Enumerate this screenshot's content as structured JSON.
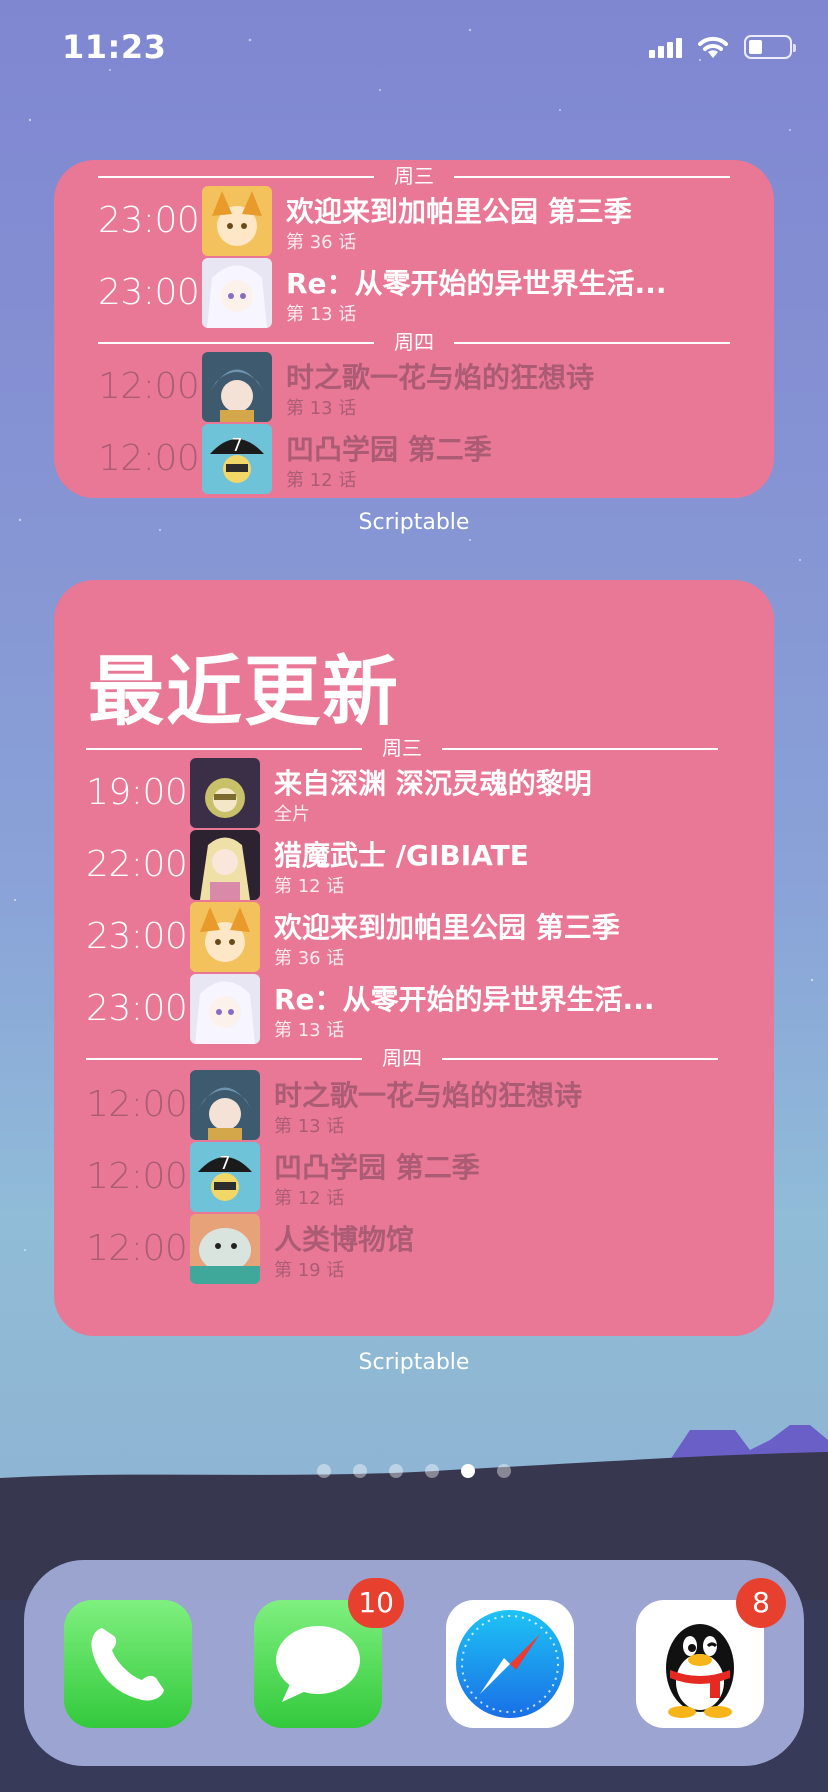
{
  "status_bar": {
    "time": "11:23",
    "battery_level": 0.3
  },
  "widgets": [
    {
      "label": "Scriptable",
      "days": [
        {
          "day": "周三",
          "items": [
            {
              "time": "23:00",
              "title": "欢迎来到加帕里公园 第三季",
              "episode": "第 36 话",
              "aired": true
            },
            {
              "time": "23:00",
              "title": "Re：从零开始的异世界生活...",
              "episode": "第 13 话",
              "aired": true
            }
          ]
        },
        {
          "day": "周四",
          "items": [
            {
              "time": "12:00",
              "title": "时之歌一花与焰的狂想诗",
              "episode": "第 13 话",
              "aired": false
            },
            {
              "time": "12:00",
              "title": "凹凸学园 第二季",
              "episode": "第 12 话",
              "aired": false
            }
          ]
        }
      ]
    },
    {
      "label": "Scriptable",
      "title": "最近更新",
      "days": [
        {
          "day": "周三",
          "items": [
            {
              "time": "19:00",
              "title": "来自深渊 深沉灵魂的黎明",
              "episode": "全片",
              "aired": true
            },
            {
              "time": "22:00",
              "title": "猎魔武士 /GIBIATE",
              "episode": "第 12 话",
              "aired": true
            },
            {
              "time": "23:00",
              "title": "欢迎来到加帕里公园 第三季",
              "episode": "第 36 话",
              "aired": true
            },
            {
              "time": "23:00",
              "title": "Re：从零开始的异世界生活...",
              "episode": "第 13 话",
              "aired": true
            }
          ]
        },
        {
          "day": "周四",
          "items": [
            {
              "time": "12:00",
              "title": "时之歌一花与焰的狂想诗",
              "episode": "第 13 话",
              "aired": false
            },
            {
              "time": "12:00",
              "title": "凹凸学园 第二季",
              "episode": "第 12 话",
              "aired": false
            },
            {
              "time": "12:00",
              "title": "人类博物馆",
              "episode": "第 19 话",
              "aired": false
            }
          ]
        }
      ]
    }
  ],
  "page_dots": {
    "count": 6,
    "active_index": 4
  },
  "dock": [
    {
      "name": "phone-app",
      "icon": "phone-icon",
      "badge": ""
    },
    {
      "name": "messages-app",
      "icon": "messages-icon",
      "badge": "10"
    },
    {
      "name": "safari-app",
      "icon": "safari-compass-icon",
      "badge": ""
    },
    {
      "name": "qq-app",
      "icon": "qq-penguin-icon",
      "badge": "8"
    }
  ]
}
